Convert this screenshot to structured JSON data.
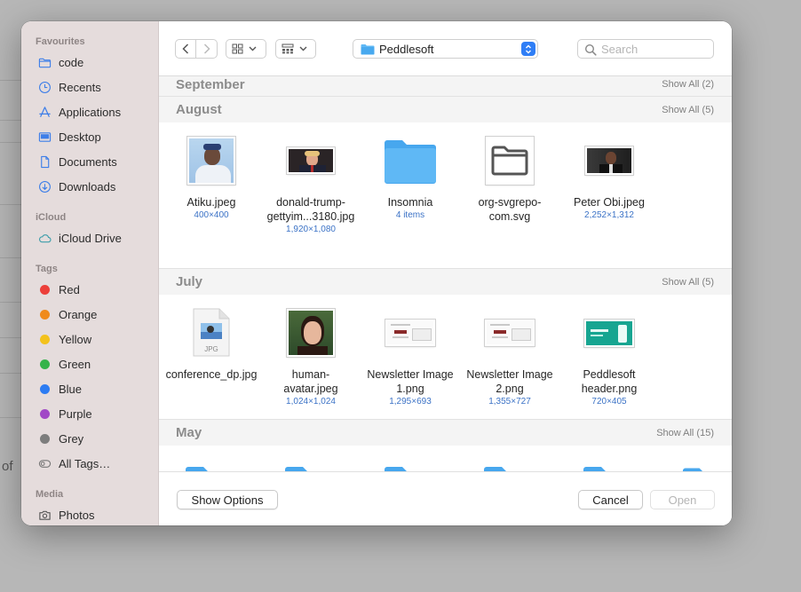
{
  "background": {
    "fragment_of": "of"
  },
  "sidebar": {
    "favourites_heading": "Favourites",
    "favourites": [
      {
        "label": "code",
        "icon": "folder-icon"
      },
      {
        "label": "Recents",
        "icon": "clock-icon"
      },
      {
        "label": "Applications",
        "icon": "applications-icon"
      },
      {
        "label": "Desktop",
        "icon": "desktop-icon"
      },
      {
        "label": "Documents",
        "icon": "document-icon"
      },
      {
        "label": "Downloads",
        "icon": "download-icon"
      }
    ],
    "icloud_heading": "iCloud",
    "icloud": [
      {
        "label": "iCloud Drive",
        "icon": "cloud-icon"
      }
    ],
    "tags_heading": "Tags",
    "tags": [
      {
        "label": "Red",
        "color": "#ec3f3a"
      },
      {
        "label": "Orange",
        "color": "#f08a1c"
      },
      {
        "label": "Yellow",
        "color": "#f3c21c"
      },
      {
        "label": "Green",
        "color": "#35b34a"
      },
      {
        "label": "Blue",
        "color": "#2d7cf2"
      },
      {
        "label": "Purple",
        "color": "#a148c6"
      },
      {
        "label": "Grey",
        "color": "#7d7d7d"
      }
    ],
    "all_tags": "All Tags…",
    "media_heading": "Media",
    "media": [
      {
        "label": "Photos",
        "icon": "camera-icon"
      }
    ]
  },
  "toolbar": {
    "location": "Peddlesoft",
    "search_placeholder": "Search"
  },
  "sections": [
    {
      "title": "September",
      "show_all": "Show All (2)",
      "items": []
    },
    {
      "title": "August",
      "show_all": "Show All (5)",
      "items": [
        {
          "name": "Atiku.jpeg",
          "meta": "400×400",
          "kind": "portrait-blue"
        },
        {
          "name": "donald-trump-gettyim...3180.jpg",
          "meta": "1,920×1,080",
          "kind": "photo-dark"
        },
        {
          "name": "Insomnia",
          "meta": "4 items",
          "kind": "folder"
        },
        {
          "name": "org-svgrepo-com.svg",
          "meta": "",
          "kind": "svg-folder"
        },
        {
          "name": "Peter Obi.jpeg",
          "meta": "2,252×1,312",
          "kind": "photo-dark2"
        }
      ]
    },
    {
      "title": "July",
      "show_all": "Show All (5)",
      "items": [
        {
          "name": "conference_dp.jpg",
          "meta": "",
          "kind": "jpg-doc"
        },
        {
          "name": "human-avatar.jpeg",
          "meta": "1,024×1,024",
          "kind": "portrait-face"
        },
        {
          "name": "Newsletter Image 1.png",
          "meta": "1,295×693",
          "kind": "newsletter"
        },
        {
          "name": "Newsletter Image 2.png",
          "meta": "1,355×727",
          "kind": "newsletter"
        },
        {
          "name": "Peddlesoft header.png",
          "meta": "720×405",
          "kind": "teal-header"
        }
      ]
    },
    {
      "title": "May",
      "show_all": "Show All (15)",
      "items": []
    }
  ],
  "footer": {
    "show_options": "Show Options",
    "cancel": "Cancel",
    "open": "Open"
  },
  "colors": {
    "accent": "#2f7ef6",
    "folder": "#5fb8f5",
    "meta_text": "#3b72c6"
  }
}
